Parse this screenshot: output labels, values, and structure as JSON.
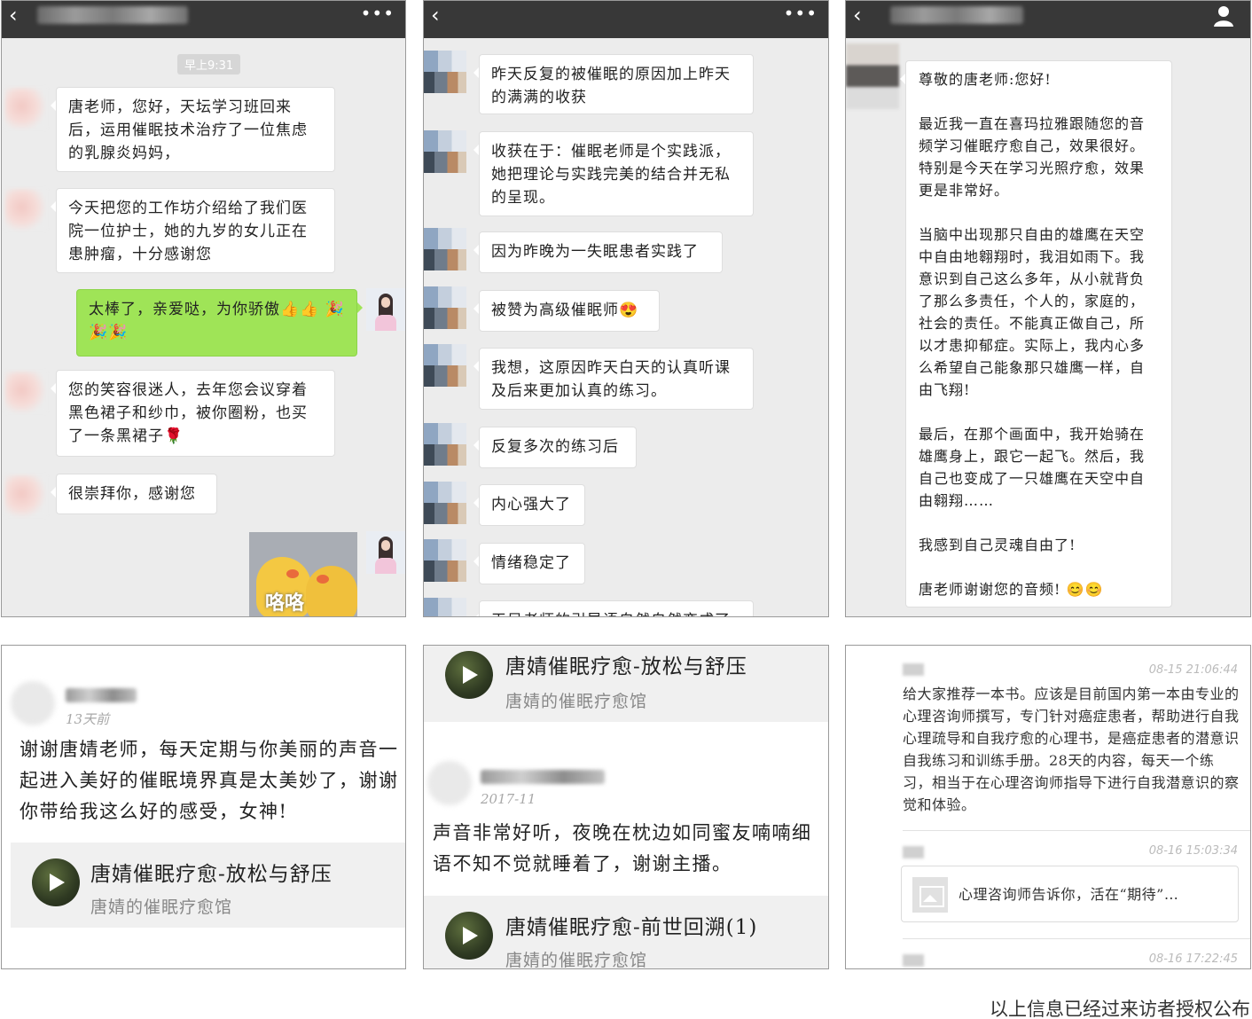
{
  "panel1": {
    "time": "早上9:31",
    "messages": [
      "唐老师，您好，天坛学习班回来后，运用催眠技术治疗了一位焦虑的乳腺炎妈妈，",
      "今天把您的工作坊介绍给了我们医院一位护士，她的九岁的女儿正在患肿瘤，十分感谢您",
      "太棒了，亲爱哒，为你骄傲👍👍 🎉🎉🎉",
      "您的笑容很迷人，去年您会议穿着黑色裙子和纱巾，被你圈粉，也买了一条黑裙子🌹",
      "很崇拜你，感谢您"
    ],
    "sticker_text": "咯咯"
  },
  "panel2": {
    "messages": [
      "昨天反复的被催眠的原因加上昨天的满满的收获",
      "收获在于：催眠老师是个实践派，她把理论与实践完美的结合并无私的呈现。",
      "因为昨晚为一失眠患者实践了",
      "被赞为高级催眠师😍",
      "我想，这原因昨天白天的认真听课及后来更加认真的练习。",
      "反复多次的练习后",
      "内心强大了",
      "情绪稳定了",
      "天吴老师的引导语自然自然变成了"
    ]
  },
  "panel3": {
    "paragraphs": [
      "尊敬的唐老师:您好!",
      "最近我一直在喜玛拉雅跟随您的音频学习催眠疗愈自己，效果很好。特别是今天在学习光照疗愈，效果更是非常好。",
      "当脑中出现那只自由的雄鹰在天空中自由地翱翔时，我泪如雨下。我意识到自己这么多年，从小就背负了那么多责任，个人的，家庭的，社会的责任。不能真正做自己，所以才患抑郁症。实际上，我内心多么希望自己能象那只雄鹰一样，自由飞翔!",
      "最后，在那个画面中，我开始骑在雄鹰身上，跟它一起飞。然后，我自己也变成了一只雄鹰在天空中自由翱翔……",
      "我感到自己灵魂自由了!",
      "唐老师谢谢您的音频! 😊😊"
    ]
  },
  "panel4": {
    "time": "13天前",
    "comment": "谢谢唐婧老师，每天定期与你美丽的声音一起进入美好的催眠境界真是太美妙了，谢谢你带给我这么好的感受，女神!",
    "audio_title": "唐婧催眠疗愈-放松与舒压",
    "audio_sub": "唐婧的催眠疗愈馆"
  },
  "panel5": {
    "audio1_title": "唐婧催眠疗愈-放松与舒压",
    "audio1_sub": "唐婧的催眠疗愈馆",
    "time": "2017-11",
    "comment": "声音非常好听，夜晚在枕边如同蜜友喃喃细语不知不觉就睡着了，谢谢主播。",
    "audio2_title": "唐婧催眠疗愈-前世回溯(1)",
    "audio2_sub": "唐婧的催眠疗愈馆"
  },
  "panel6": {
    "time1": "08-15 21:06:44",
    "text1": "给大家推荐一本书。应该是目前国内第一本由专业的心理咨询师撰写，专门针对癌症患者，帮助进行自我心理疏导和自我疗愈的心理书，是癌症患者的潜意识自我练习和训练手册。28天的内容，每天一个练习，相当于在心理咨询师指导下进行自我潜意识的察觉和体验。",
    "time2": "08-16 15:03:34",
    "link_text": "心理咨询师告诉你，活在“期待”…",
    "time3": "08-16 17:22:45"
  },
  "caption": "以上信息已经过来访者授权公布"
}
